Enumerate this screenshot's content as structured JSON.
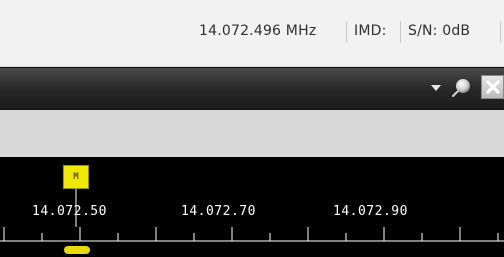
{
  "status_bar": {
    "frequency": "14.072.496 MHz",
    "imd": "IMD:",
    "snr": "S/N: 0dB"
  },
  "title_bar": {
    "icons": [
      "dropdown-arrow-icon",
      "pin-icon",
      "close-icon"
    ],
    "close_icon_color": "#ffffff"
  },
  "scale": {
    "marker_label": "M",
    "marker_color": "#f0e800",
    "labels": [
      "14.072.50",
      "14.072.70",
      "14.072.90"
    ],
    "background": "#000000",
    "tick_color": "#ffffff"
  }
}
